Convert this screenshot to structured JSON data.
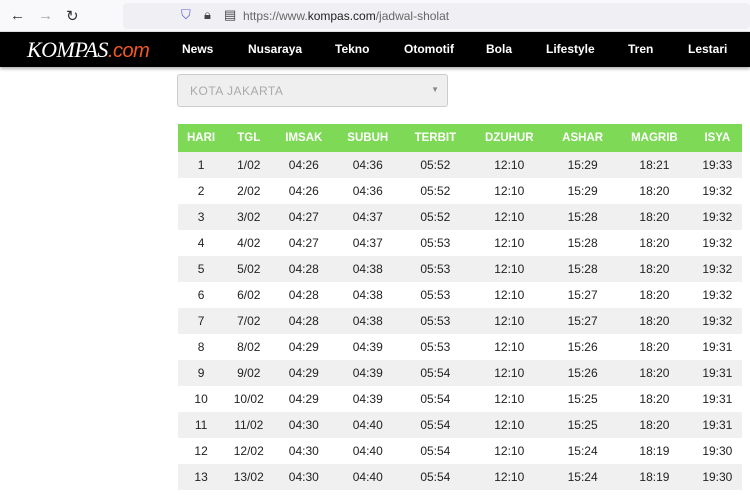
{
  "browser": {
    "url_prefix": "https://www.",
    "url_domain": "kompas.com",
    "url_path": "/jadwal-sholat"
  },
  "nav": {
    "logo_main": "KOMPAS",
    "logo_suffix": ".com",
    "items": [
      "News",
      "Nusaraya",
      "Tekno",
      "Otomotif",
      "Bola",
      "Lifestyle",
      "Tren",
      "Lestari"
    ]
  },
  "city_select": {
    "value": "KOTA JAKARTA"
  },
  "table": {
    "headers": [
      "HARI",
      "TGL",
      "IMSAK",
      "SUBUH",
      "TERBIT",
      "DZUHUR",
      "ASHAR",
      "MAGRIB",
      "ISYA"
    ],
    "rows": [
      [
        "1",
        "1/02",
        "04:26",
        "04:36",
        "05:52",
        "12:10",
        "15:29",
        "18:21",
        "19:33"
      ],
      [
        "2",
        "2/02",
        "04:26",
        "04:36",
        "05:52",
        "12:10",
        "15:29",
        "18:20",
        "19:32"
      ],
      [
        "3",
        "3/02",
        "04:27",
        "04:37",
        "05:52",
        "12:10",
        "15:28",
        "18:20",
        "19:32"
      ],
      [
        "4",
        "4/02",
        "04:27",
        "04:37",
        "05:53",
        "12:10",
        "15:28",
        "18:20",
        "19:32"
      ],
      [
        "5",
        "5/02",
        "04:28",
        "04:38",
        "05:53",
        "12:10",
        "15:28",
        "18:20",
        "19:32"
      ],
      [
        "6",
        "6/02",
        "04:28",
        "04:38",
        "05:53",
        "12:10",
        "15:27",
        "18:20",
        "19:32"
      ],
      [
        "7",
        "7/02",
        "04:28",
        "04:38",
        "05:53",
        "12:10",
        "15:27",
        "18:20",
        "19:32"
      ],
      [
        "8",
        "8/02",
        "04:29",
        "04:39",
        "05:53",
        "12:10",
        "15:26",
        "18:20",
        "19:31"
      ],
      [
        "9",
        "9/02",
        "04:29",
        "04:39",
        "05:54",
        "12:10",
        "15:26",
        "18:20",
        "19:31"
      ],
      [
        "10",
        "10/02",
        "04:29",
        "04:39",
        "05:54",
        "12:10",
        "15:25",
        "18:20",
        "19:31"
      ],
      [
        "11",
        "11/02",
        "04:30",
        "04:40",
        "05:54",
        "12:10",
        "15:25",
        "18:20",
        "19:31"
      ],
      [
        "12",
        "12/02",
        "04:30",
        "04:40",
        "05:54",
        "12:10",
        "15:24",
        "18:19",
        "19:30"
      ],
      [
        "13",
        "13/02",
        "04:30",
        "04:40",
        "05:54",
        "12:10",
        "15:24",
        "18:19",
        "19:30"
      ]
    ]
  },
  "colors": {
    "header_bg": "#7ed957",
    "nav_bg": "#000000",
    "logo_accent": "#f05a22"
  }
}
